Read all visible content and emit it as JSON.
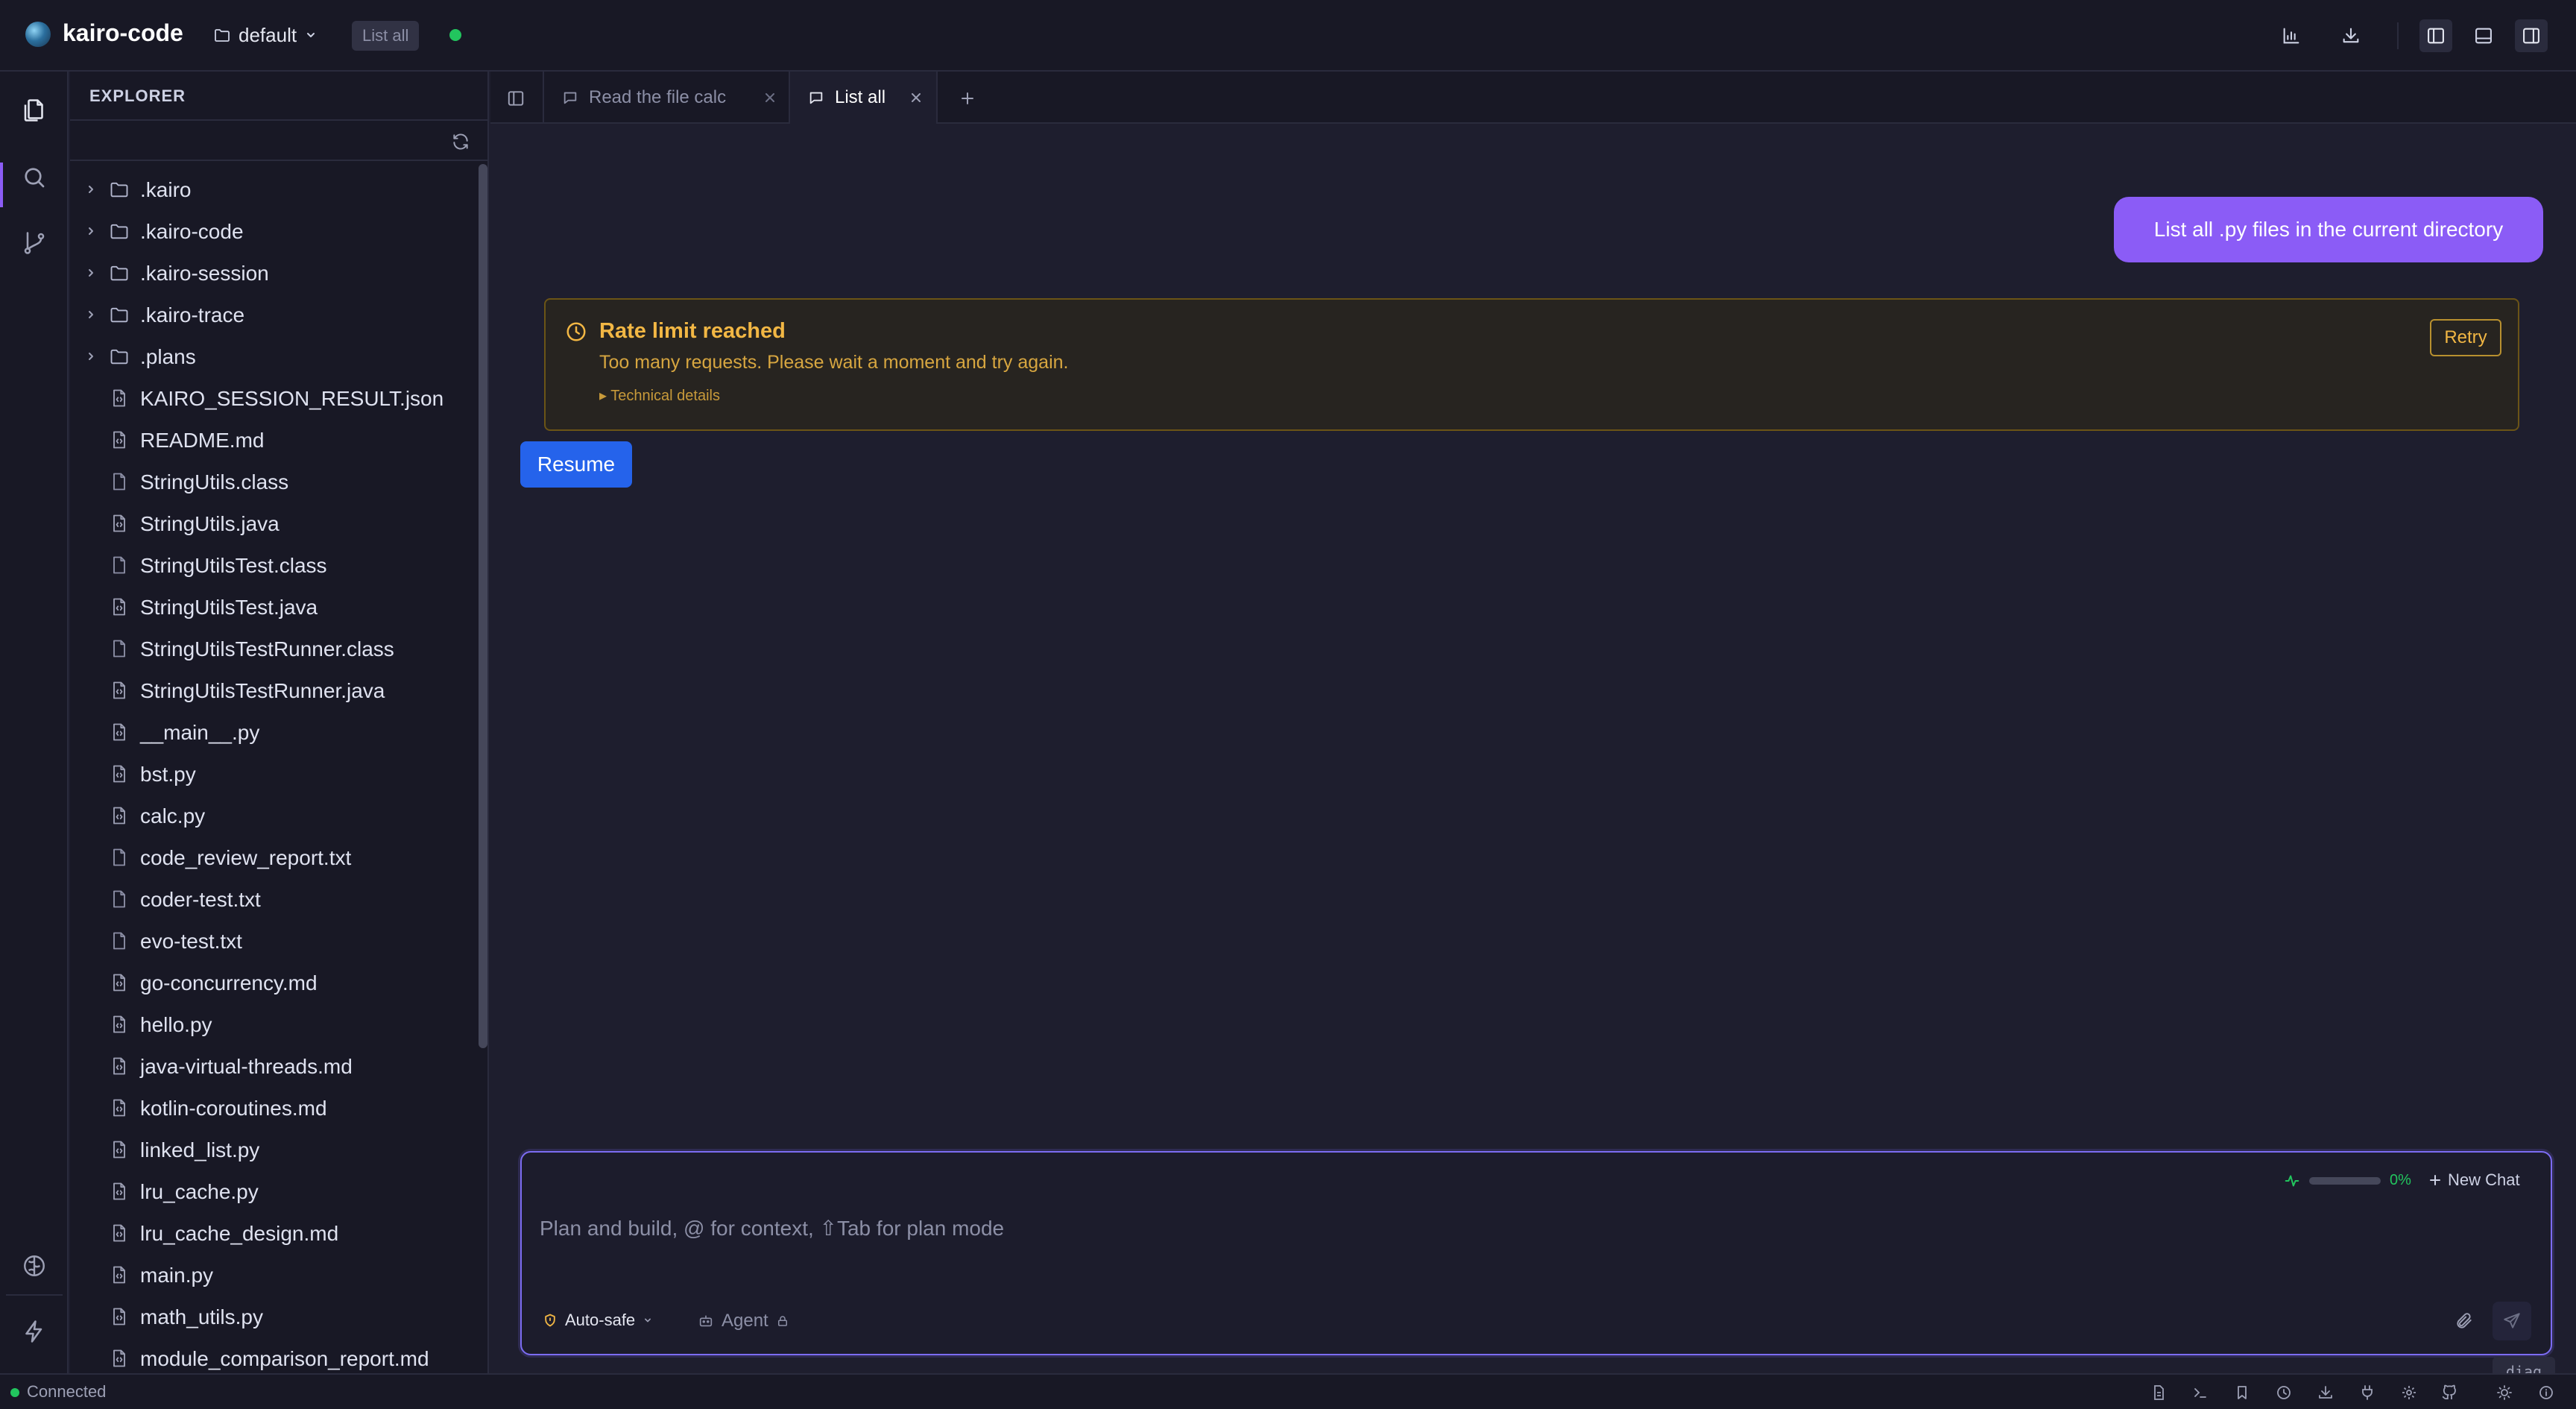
{
  "app": {
    "title": "kairo-code",
    "workspace": "default",
    "session_badge": "List all"
  },
  "explorer": {
    "title": "EXPLORER",
    "items": [
      {
        "label": ".kairo",
        "type": "folder"
      },
      {
        "label": ".kairo-code",
        "type": "folder"
      },
      {
        "label": ".kairo-session",
        "type": "folder"
      },
      {
        "label": ".kairo-trace",
        "type": "folder"
      },
      {
        "label": ".plans",
        "type": "folder"
      },
      {
        "label": "KAIRO_SESSION_RESULT.json",
        "type": "code-file"
      },
      {
        "label": "README.md",
        "type": "code-file"
      },
      {
        "label": "StringUtils.class",
        "type": "file"
      },
      {
        "label": "StringUtils.java",
        "type": "code-file"
      },
      {
        "label": "StringUtilsTest.class",
        "type": "file"
      },
      {
        "label": "StringUtilsTest.java",
        "type": "code-file"
      },
      {
        "label": "StringUtilsTestRunner.class",
        "type": "file"
      },
      {
        "label": "StringUtilsTestRunner.java",
        "type": "code-file"
      },
      {
        "label": "__main__.py",
        "type": "code-file"
      },
      {
        "label": "bst.py",
        "type": "code-file"
      },
      {
        "label": "calc.py",
        "type": "code-file"
      },
      {
        "label": "code_review_report.txt",
        "type": "file"
      },
      {
        "label": "coder-test.txt",
        "type": "file"
      },
      {
        "label": "evo-test.txt",
        "type": "file"
      },
      {
        "label": "go-concurrency.md",
        "type": "code-file"
      },
      {
        "label": "hello.py",
        "type": "code-file"
      },
      {
        "label": "java-virtual-threads.md",
        "type": "code-file"
      },
      {
        "label": "kotlin-coroutines.md",
        "type": "code-file"
      },
      {
        "label": "linked_list.py",
        "type": "code-file"
      },
      {
        "label": "lru_cache.py",
        "type": "code-file"
      },
      {
        "label": "lru_cache_design.md",
        "type": "code-file"
      },
      {
        "label": "main.py",
        "type": "code-file"
      },
      {
        "label": "math_utils.py",
        "type": "code-file"
      },
      {
        "label": "module_comparison_report.md",
        "type": "code-file"
      }
    ]
  },
  "tabs": [
    {
      "label": "Read the file calc",
      "active": false
    },
    {
      "label": "List all",
      "active": true
    }
  ],
  "chat": {
    "user_message": "List all .py files in the current directory",
    "error": {
      "title": "Rate limit reached",
      "message": "Too many requests. Please wait a moment and try again.",
      "details_toggle": "▸ Technical details",
      "retry_label": "Retry"
    },
    "resume_label": "Resume"
  },
  "composer": {
    "context_usage": 0,
    "context_pct_label": "0%",
    "new_chat_label": "New Chat",
    "placeholder": "Plan and build, @ for context, ⇧Tab for plan mode",
    "value": "",
    "mode_label": "Auto-safe",
    "agent_label": "Agent"
  },
  "diag_label": "diag",
  "statusbar": {
    "connection": "Connected"
  },
  "colors": {
    "accent": "#8b5cf6",
    "primary_button": "#2563eb",
    "warning": "#f2b744",
    "success": "#22c55e"
  }
}
